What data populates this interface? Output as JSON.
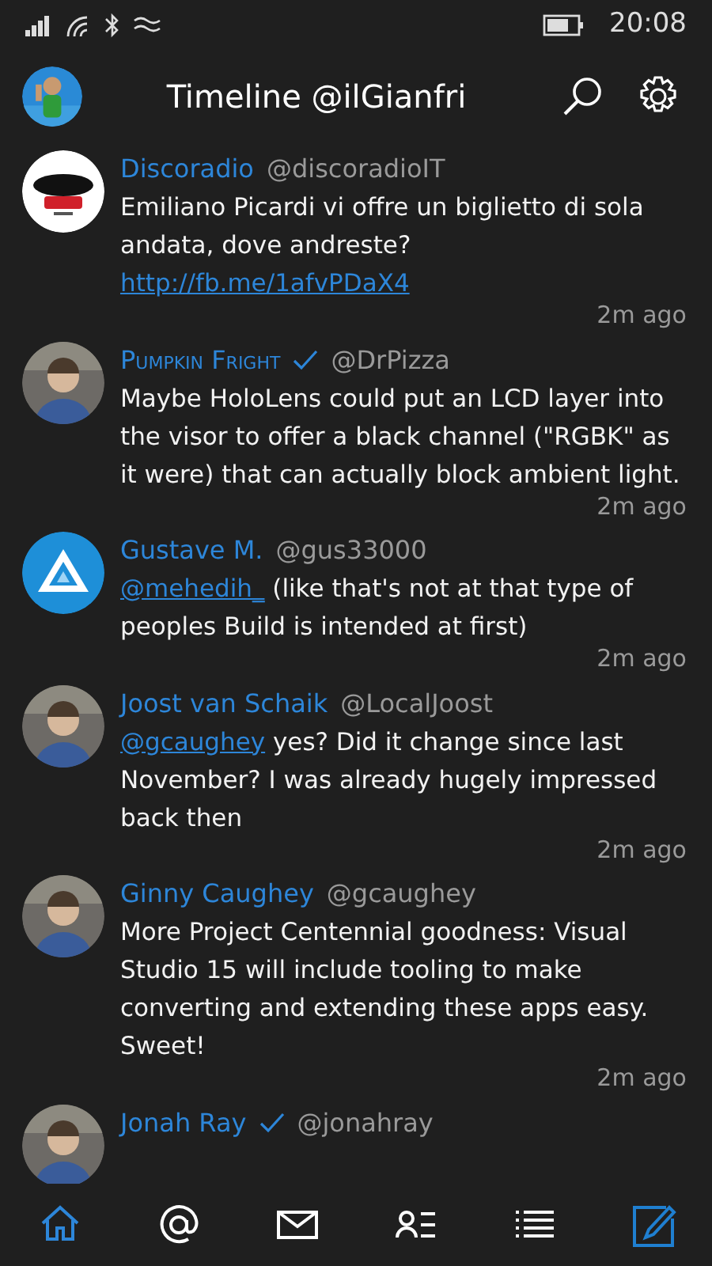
{
  "status_bar": {
    "time": "20:08"
  },
  "header": {
    "title": "Timeline @ilGianfri"
  },
  "tweets": [
    {
      "name": "Discoradio",
      "small_caps": false,
      "verified": false,
      "handle": "@discoradioIT",
      "segments": [
        {
          "kind": "text",
          "text": "Emiliano Picardi vi offre un biglietto di sola andata, dove andreste? "
        },
        {
          "kind": "link",
          "text": "http://fb.me/1afvPDaX4"
        }
      ],
      "time": "2m ago"
    },
    {
      "name": "Pumpkin Fright",
      "small_caps": true,
      "verified": true,
      "handle": "@DrPizza",
      "segments": [
        {
          "kind": "text",
          "text": "Maybe HoloLens could put an LCD layer into the visor to offer a black channel (\"RGBK\" as it were) that can actually block ambient light."
        }
      ],
      "time": "2m ago"
    },
    {
      "name": "Gustave M.",
      "small_caps": false,
      "verified": false,
      "handle": "@gus33000",
      "segments": [
        {
          "kind": "link",
          "text": "@mehedih_"
        },
        {
          "kind": "text",
          "text": " (like that's not at that type of peoples Build is intended at first)"
        }
      ],
      "time": "2m ago"
    },
    {
      "name": "Joost van Schaik",
      "small_caps": false,
      "verified": false,
      "handle": "@LocalJoost",
      "segments": [
        {
          "kind": "link",
          "text": "@gcaughey"
        },
        {
          "kind": "text",
          "text": " yes? Did it change since last November? I was already hugely impressed back then"
        }
      ],
      "time": "2m ago"
    },
    {
      "name": "Ginny Caughey",
      "small_caps": false,
      "verified": false,
      "handle": "@gcaughey",
      "segments": [
        {
          "kind": "text",
          "text": "More Project Centennial goodness: Visual Studio 15 will include tooling to make converting and extending these apps easy. Sweet!"
        }
      ],
      "time": "2m ago"
    },
    {
      "name": "Jonah Ray",
      "small_caps": false,
      "verified": true,
      "handle": "@jonahray"
    }
  ],
  "nav": [
    {
      "kind": "home",
      "selected": true
    },
    {
      "kind": "mentions",
      "selected": false
    },
    {
      "kind": "messages",
      "selected": false
    },
    {
      "kind": "people",
      "selected": false
    },
    {
      "kind": "lists",
      "selected": false
    },
    {
      "kind": "compose",
      "selected": false
    }
  ]
}
